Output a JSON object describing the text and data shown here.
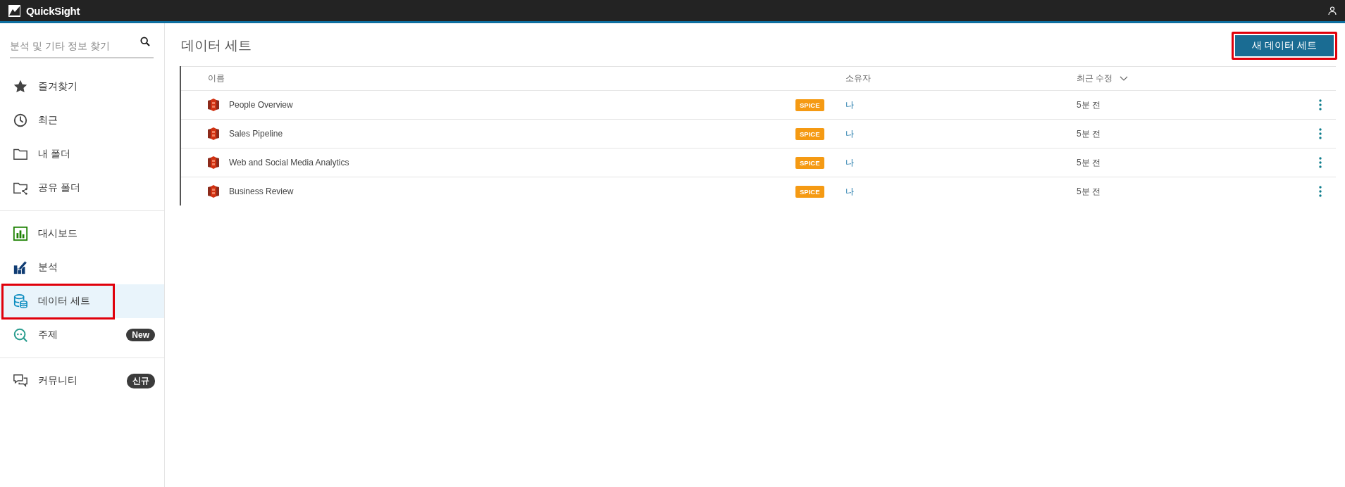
{
  "app": {
    "title": "QuickSight"
  },
  "search": {
    "placeholder": "분석 및 기타 정보 찾기"
  },
  "sidebar": {
    "groups": [
      {
        "items": [
          {
            "label": "즐겨찾기",
            "selected": false,
            "highlighted": false
          },
          {
            "label": "최근",
            "selected": false,
            "highlighted": false
          },
          {
            "label": "내 폴더",
            "selected": false,
            "highlighted": false
          },
          {
            "label": "공유 폴더",
            "selected": false,
            "highlighted": false
          }
        ]
      },
      {
        "items": [
          {
            "label": "대시보드",
            "selected": false,
            "highlighted": false
          },
          {
            "label": "분석",
            "selected": false,
            "highlighted": false
          },
          {
            "label": "데이터 세트",
            "selected": true,
            "highlighted": true
          },
          {
            "label": "주제",
            "selected": false,
            "highlighted": false,
            "badge": "New"
          }
        ]
      },
      {
        "items": [
          {
            "label": "커뮤니티",
            "selected": false,
            "highlighted": false,
            "badge": "신규"
          }
        ]
      }
    ]
  },
  "page": {
    "title": "데이터 세트",
    "new_button": {
      "label": "새 데이터 세트",
      "highlighted": true
    }
  },
  "table": {
    "columns": [
      {
        "label": "이름",
        "sorted": false
      },
      {
        "label": "소유자",
        "sorted": false
      },
      {
        "label": "최근 수정",
        "sorted": true
      }
    ],
    "rows": [
      {
        "name": "People Overview",
        "badge": "SPICE",
        "owner": "나",
        "modified": "5분 전"
      },
      {
        "name": "Sales Pipeline",
        "badge": "SPICE",
        "owner": "나",
        "modified": "5분 전"
      },
      {
        "name": "Web and Social Media Analytics",
        "badge": "SPICE",
        "owner": "나",
        "modified": "5분 전"
      },
      {
        "name": "Business Review",
        "badge": "SPICE",
        "owner": "나",
        "modified": "5분 전"
      }
    ]
  }
}
